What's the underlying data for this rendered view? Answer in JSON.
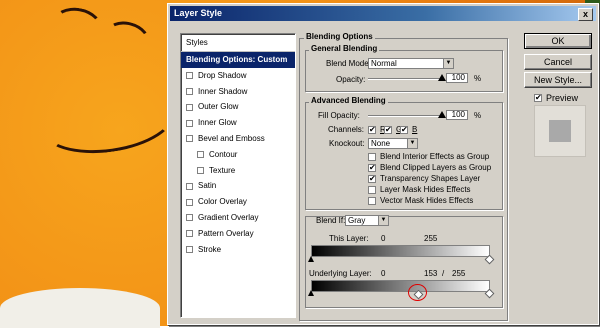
{
  "window": {
    "title": "Layer Style",
    "close_glyph": "x"
  },
  "styles_panel": {
    "header": "Styles",
    "items": [
      {
        "label": "Blending Options: Custom",
        "selected": true,
        "checkbox": false,
        "indent": false
      },
      {
        "label": "Drop Shadow",
        "checkbox": true,
        "checked": false,
        "indent": false
      },
      {
        "label": "Inner Shadow",
        "checkbox": true,
        "checked": false,
        "indent": false
      },
      {
        "label": "Outer Glow",
        "checkbox": true,
        "checked": false,
        "indent": false
      },
      {
        "label": "Inner Glow",
        "checkbox": true,
        "checked": false,
        "indent": false
      },
      {
        "label": "Bevel and Emboss",
        "checkbox": true,
        "checked": false,
        "indent": false
      },
      {
        "label": "Contour",
        "checkbox": true,
        "checked": false,
        "indent": true
      },
      {
        "label": "Texture",
        "checkbox": true,
        "checked": false,
        "indent": true
      },
      {
        "label": "Satin",
        "checkbox": true,
        "checked": false,
        "indent": false
      },
      {
        "label": "Color Overlay",
        "checkbox": true,
        "checked": false,
        "indent": false
      },
      {
        "label": "Gradient Overlay",
        "checkbox": true,
        "checked": false,
        "indent": false
      },
      {
        "label": "Pattern Overlay",
        "checkbox": true,
        "checked": false,
        "indent": false
      },
      {
        "label": "Stroke",
        "checkbox": true,
        "checked": false,
        "indent": false
      }
    ]
  },
  "blending_options": {
    "title": "Blending Options",
    "general": {
      "title": "General Blending",
      "blend_mode_label": "Blend Mode:",
      "blend_mode_value": "Normal",
      "opacity_label": "Opacity:",
      "opacity_value": "100",
      "opacity_unit": "%"
    },
    "advanced": {
      "title": "Advanced Blending",
      "fill_opacity_label": "Fill Opacity:",
      "fill_opacity_value": "100",
      "fill_opacity_unit": "%",
      "channels_label": "Channels:",
      "channels": [
        {
          "label": "R",
          "checked": true
        },
        {
          "label": "G",
          "checked": true
        },
        {
          "label": "B",
          "checked": true
        }
      ],
      "knockout_label": "Knockout:",
      "knockout_value": "None",
      "options": [
        {
          "label": "Blend Interior Effects as Group",
          "checked": false
        },
        {
          "label": "Blend Clipped Layers as Group",
          "checked": true
        },
        {
          "label": "Transparency Shapes Layer",
          "checked": true
        },
        {
          "label": "Layer Mask Hides Effects",
          "checked": false
        },
        {
          "label": "Vector Mask Hides Effects",
          "checked": false
        }
      ]
    },
    "blend_if": {
      "label": "Blend If:",
      "value": "Gray",
      "this_layer_label": "This Layer:",
      "this_layer_min": "0",
      "this_layer_max": "255",
      "underlying_label": "Underlying Layer:",
      "underlying_min": "0",
      "underlying_split": "153",
      "underlying_sep": "/",
      "underlying_max": "255"
    }
  },
  "buttons": {
    "ok": "OK",
    "cancel": "Cancel",
    "new_style": "New Style...",
    "preview_label": "Preview",
    "preview_checked": true,
    "check_glyph": "✔"
  },
  "colors": {
    "titlebar": "#0a246a",
    "dialog_bg": "#d4d0c8",
    "highlight_circle": "#e00000"
  }
}
